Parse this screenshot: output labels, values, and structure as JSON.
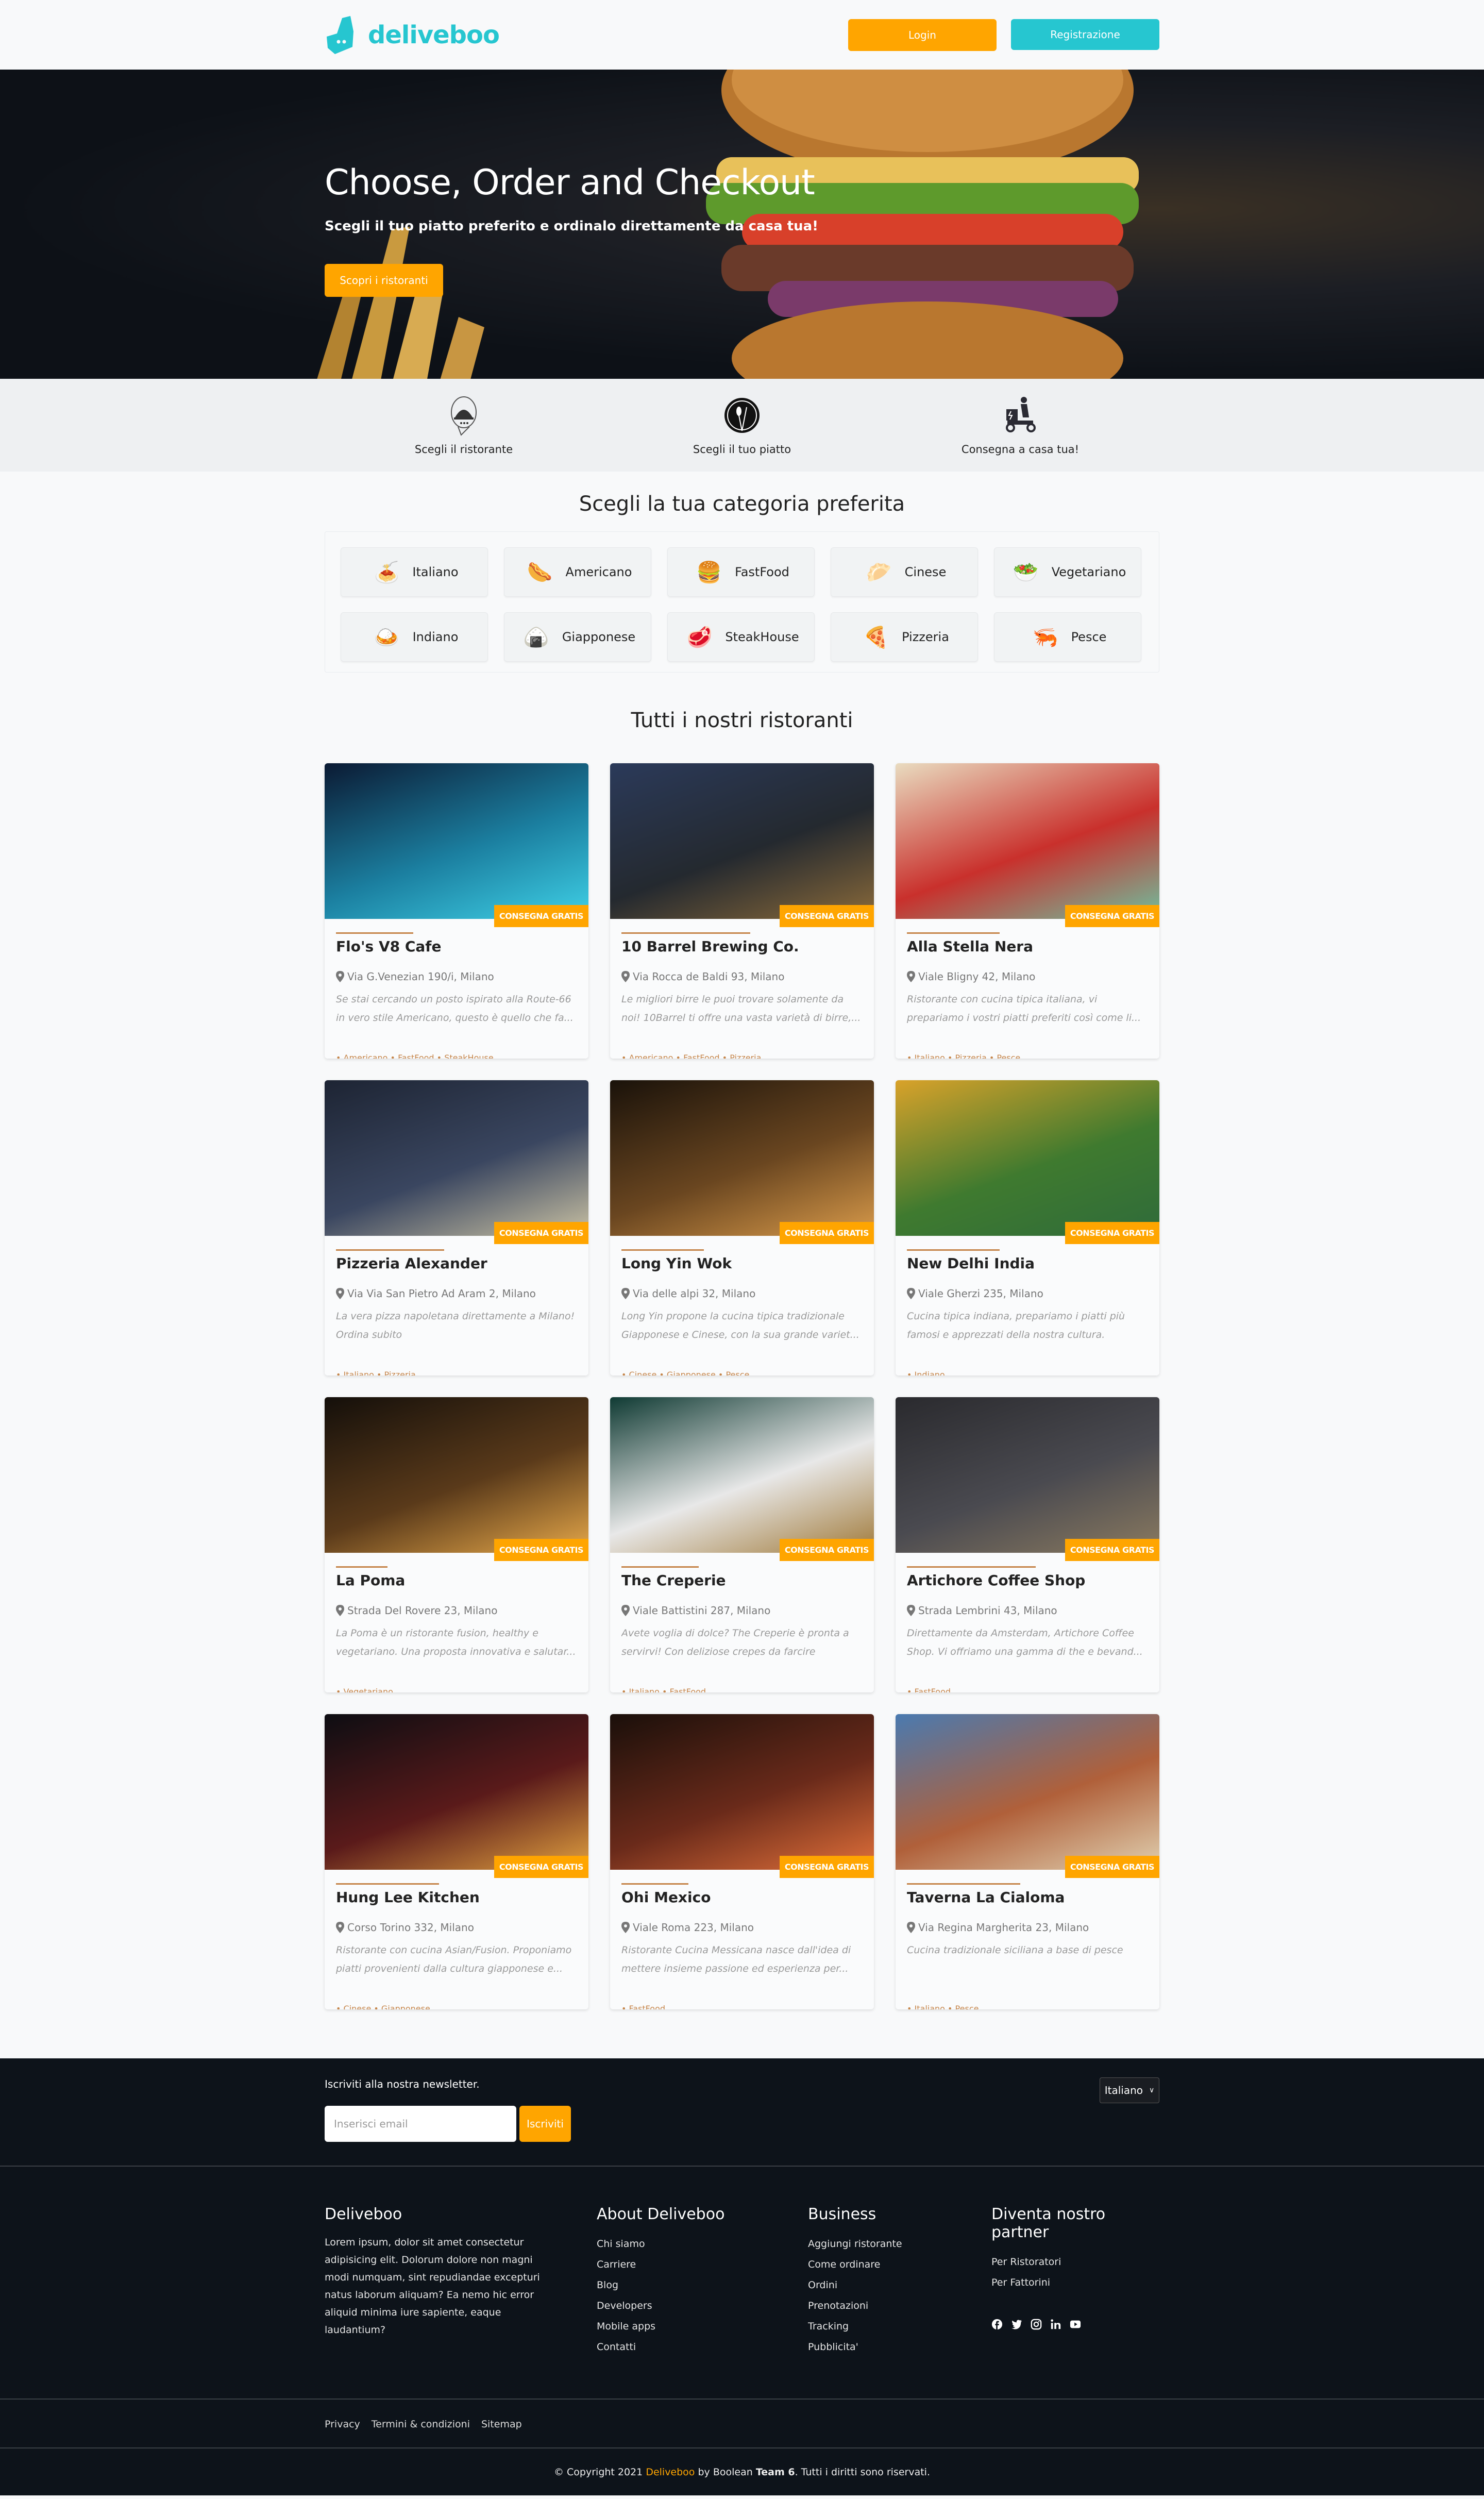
{
  "header": {
    "brand": "deliveboo",
    "login_label": "Login",
    "register_label": "Registrazione"
  },
  "hero": {
    "title": "Choose, Order and Checkout",
    "subtitle": "Scegli il tuo piatto preferito e ordinalo direttamente da casa tua!",
    "cta_label": "Scopri i ristoranti"
  },
  "steps": [
    {
      "icon": "restaurant-cloche-icon",
      "label": "Scegli il ristorante"
    },
    {
      "icon": "plate-cutlery-icon",
      "label": "Scegli il tuo piatto"
    },
    {
      "icon": "delivery-scooter-icon",
      "label": "Consegna a casa tua!"
    }
  ],
  "categories": {
    "title": "Scegli la tua categoria preferita",
    "items": [
      {
        "label": "Italiano",
        "icon": "pasta-icon",
        "glyph": "🍝"
      },
      {
        "label": "Americano",
        "icon": "hotdog-icon",
        "glyph": "🌭"
      },
      {
        "label": "FastFood",
        "icon": "burger-icon",
        "glyph": "🍔"
      },
      {
        "label": "Cinese",
        "icon": "dumpling-icon",
        "glyph": "🥟"
      },
      {
        "label": "Vegetariano",
        "icon": "salad-bowl-icon",
        "glyph": "🥗"
      },
      {
        "label": "Indiano",
        "icon": "curry-icon",
        "glyph": "🍛"
      },
      {
        "label": "Giapponese",
        "icon": "onigiri-icon",
        "glyph": "🍙"
      },
      {
        "label": "SteakHouse",
        "icon": "steak-icon",
        "glyph": "🥩"
      },
      {
        "label": "Pizzeria",
        "icon": "pizza-icon",
        "glyph": "🍕"
      },
      {
        "label": "Pesce",
        "icon": "seafood-icon",
        "glyph": "🦐"
      }
    ]
  },
  "restaurants": {
    "title": "Tutti i nostri ristoranti",
    "badge": "CONSEGNA GRATIS",
    "items": [
      {
        "name": "Flo's V8 Cafe",
        "address": "Via G.Venezian 190/i, Milano",
        "description": "Se stai cercando un posto ispirato alla Route-66 in vero stile Americano, questo è quello che fa...",
        "tags": "• Americano • FastFood • SteakHouse",
        "colors": [
          "#0b1a33",
          "#1b7fa0",
          "#3fd0e6"
        ]
      },
      {
        "name": "10 Barrel Brewing Co.",
        "address": "Via Rocca de Baldi 93, Milano",
        "description": "Le migliori birre le puoi trovare solamente da noi! 10Barrel ti offre una vasta varietà di birre,...",
        "tags": "• Americano • FastFood • Pizzeria",
        "colors": [
          "#2b3a5a",
          "#24292f",
          "#8a6a3a"
        ]
      },
      {
        "name": "Alla Stella Nera",
        "address": "Viale Bligny 42, Milano",
        "description": "Ristorante con cucina tipica italiana, vi prepariamo i vostri piatti preferiti così come li...",
        "tags": "• Italiano • Pizzeria • Pesce",
        "colors": [
          "#e9dcc0",
          "#c9302c",
          "#6fbf9f"
        ]
      },
      {
        "name": "Pizzeria Alexander",
        "address": "Via Via San Pietro Ad Aram 2, Milano",
        "description": "La vera pizza napoletana direttamente a Milano! Ordina subito",
        "tags": "• Italiano • Pizzeria",
        "colors": [
          "#1d2433",
          "#3a4660",
          "#c9c1a3"
        ]
      },
      {
        "name": "Long Yin Wok",
        "address": "Via delle alpi 32, Milano",
        "description": "Long Yin propone la cucina tipica tradizionale Giapponese e Cinese, con la sua grande variet...",
        "tags": "• Cinese • Giapponese • Pesce",
        "colors": [
          "#1a120a",
          "#6a4620",
          "#d89a4a"
        ]
      },
      {
        "name": "New Delhi India",
        "address": "Viale Gherzi 235, Milano",
        "description": "Cucina tipica indiana, prepariamo i piatti più famosi e apprezzati della nostra cultura.",
        "tags": "• Indiano",
        "colors": [
          "#d9a22a",
          "#3f7a2f",
          "#2f6b3a"
        ]
      },
      {
        "name": "La Poma",
        "address": "Strada Del Rovere 23, Milano",
        "description": "La Poma è un ristorante fusion, healthy e vegetariano. Una proposta innovativa e salutar...",
        "tags": "• Vegetariano",
        "colors": [
          "#140f0a",
          "#5a3a1a",
          "#e6a84a"
        ]
      },
      {
        "name": "The Creperie",
        "address": "Viale Battistini 287, Milano",
        "description": "Avete voglia di dolce? The Creperie è pronta a servirvi! Con deliziose crepes da farcire second...",
        "tags": "• Italiano • FastFood",
        "colors": [
          "#0f3a33",
          "#e8e8e8",
          "#a07a3a"
        ]
      },
      {
        "name": "Artichore Coffee Shop",
        "address": "Strada Lembrini 43, Milano",
        "description": "Direttamente da Amsterdam, Artichore Coffee Shop. Vi offriamo una gamma di the e bevand...",
        "tags": "• FastFood",
        "colors": [
          "#2a2a2e",
          "#4a4a50",
          "#8a7a60"
        ]
      },
      {
        "name": "Hung Lee Kitchen",
        "address": "Corso Torino 332, Milano",
        "description": "Ristorante con cucina Asian/Fusion. Proponiamo piatti provenienti dalla cultura giapponese e...",
        "tags": "• Cinese • Giapponese",
        "colors": [
          "#0d0d12",
          "#5a1a1a",
          "#e0a040"
        ]
      },
      {
        "name": "Ohi Mexico",
        "address": "Viale Roma 223, Milano",
        "description": "Ristorante Cucina Messicana nasce dall'idea di mettere insieme passione ed esperienza per...",
        "tags": "• FastFood",
        "colors": [
          "#1a0f0a",
          "#6a2a1a",
          "#e0703a"
        ]
      },
      {
        "name": "Taverna La Cialoma",
        "address": "Via Regina Margherita 23, Milano",
        "description": "Cucina tradizionale siciliana a base di pesce",
        "tags": "• Italiano • Pesce",
        "colors": [
          "#4a7ab0",
          "#b0603a",
          "#e0d0b0"
        ]
      }
    ]
  },
  "footer": {
    "newsletter_label": "Iscriviti alla nostra newsletter.",
    "email_placeholder": "Inserisci email",
    "subscribe_label": "Iscriviti",
    "language": "Italiano",
    "about": {
      "title": "Deliveboo",
      "text": "Lorem ipsum, dolor sit amet consectetur adipisicing elit. Dolorum dolore non magni modi numquam, sint repudiandae excepturi natus laborum aliquam? Ea nemo hic error aliquid minima iure sapiente, eaque laudantium?"
    },
    "columns": [
      {
        "title": "About Deliveboo",
        "links": [
          "Chi siamo",
          "Carriere",
          "Blog",
          "Developers",
          "Mobile apps",
          "Contatti"
        ]
      },
      {
        "title": "Business",
        "links": [
          "Aggiungi ristorante",
          "Come ordinare",
          "Ordini",
          "Prenotazioni",
          "Tracking",
          "Pubblicita'"
        ]
      },
      {
        "title": "Diventa nostro partner",
        "links": [
          "Per Ristoratori",
          "Per Fattorini"
        ]
      }
    ],
    "socials": [
      "facebook-icon",
      "twitter-icon",
      "instagram-icon",
      "linkedin-icon",
      "youtube-icon"
    ],
    "legal": [
      "Privacy",
      "Termini & condizioni",
      "Sitemap"
    ],
    "copyright": {
      "prefix": "© Copyright 2021 ",
      "brand": "Deliveboo",
      "middle": " by Boolean ",
      "team": "Team 6",
      "suffix": ". Tutti i diritti sono riservati."
    }
  },
  "colors": {
    "brand_teal": "#26c6d0",
    "accent_orange": "#ffa500",
    "tag_brown": "#c6864b",
    "footer_bg": "#0d131a"
  }
}
